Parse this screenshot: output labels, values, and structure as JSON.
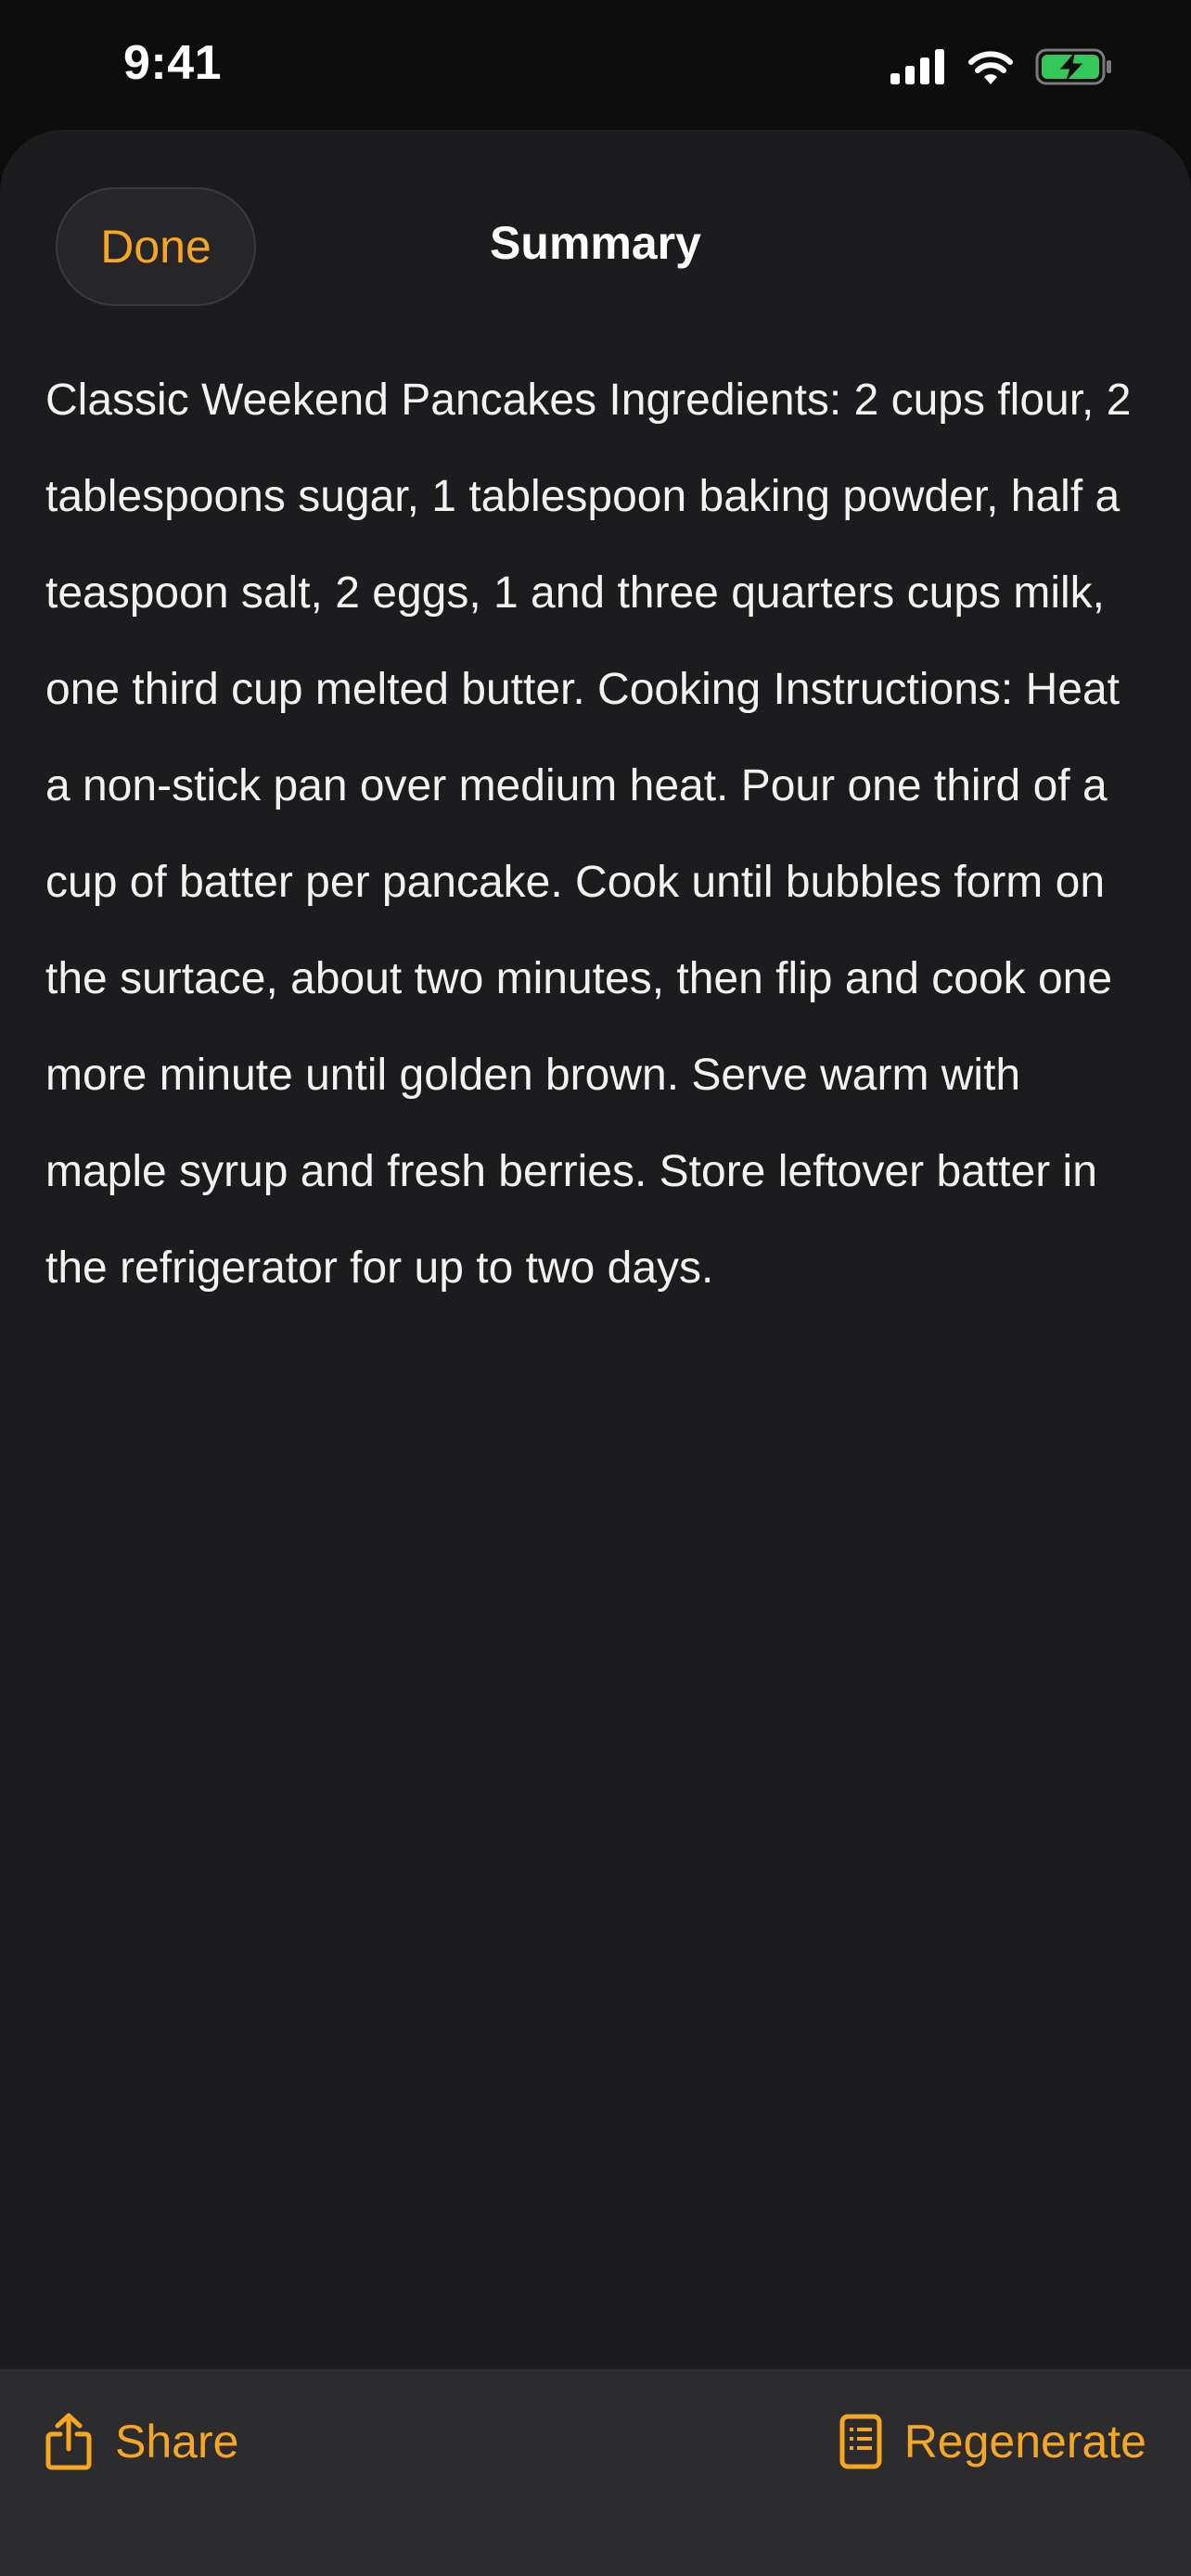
{
  "status_bar": {
    "time": "9:41",
    "icons": [
      "cellular-signal-icon",
      "wifi-icon",
      "battery-charging-icon"
    ],
    "battery_color": "#34c759"
  },
  "sheet": {
    "done_label": "Done",
    "title": "Summary",
    "summary_text": "Classic Weekend Pancakes Ingredients: 2 cups flour, 2 tablespoons sugar, 1 tablespoon baking powder, half a teaspoon salt, 2 eggs, 1 and three quarters cups milk, one third cup melted butter. Cooking Instructions: Heat a non-stick pan over medium heat. Pour one third of a cup of batter per pancake. Cook until bubbles form on the surtace, about two minutes, then flip and cook one more minute until golden brown. Serve warm with maple syrup and fresh berries. Store leftover batter in the refrigerator for up to two days."
  },
  "toolbar": {
    "share_label": "Share",
    "share_icon": "share-icon",
    "regenerate_label": "Regenerate",
    "regenerate_icon": "document-list-icon"
  },
  "colors": {
    "accent": "#f5a623",
    "sheet_background": "#1c1c1e",
    "toolbar_background": "#2c2c2e"
  }
}
